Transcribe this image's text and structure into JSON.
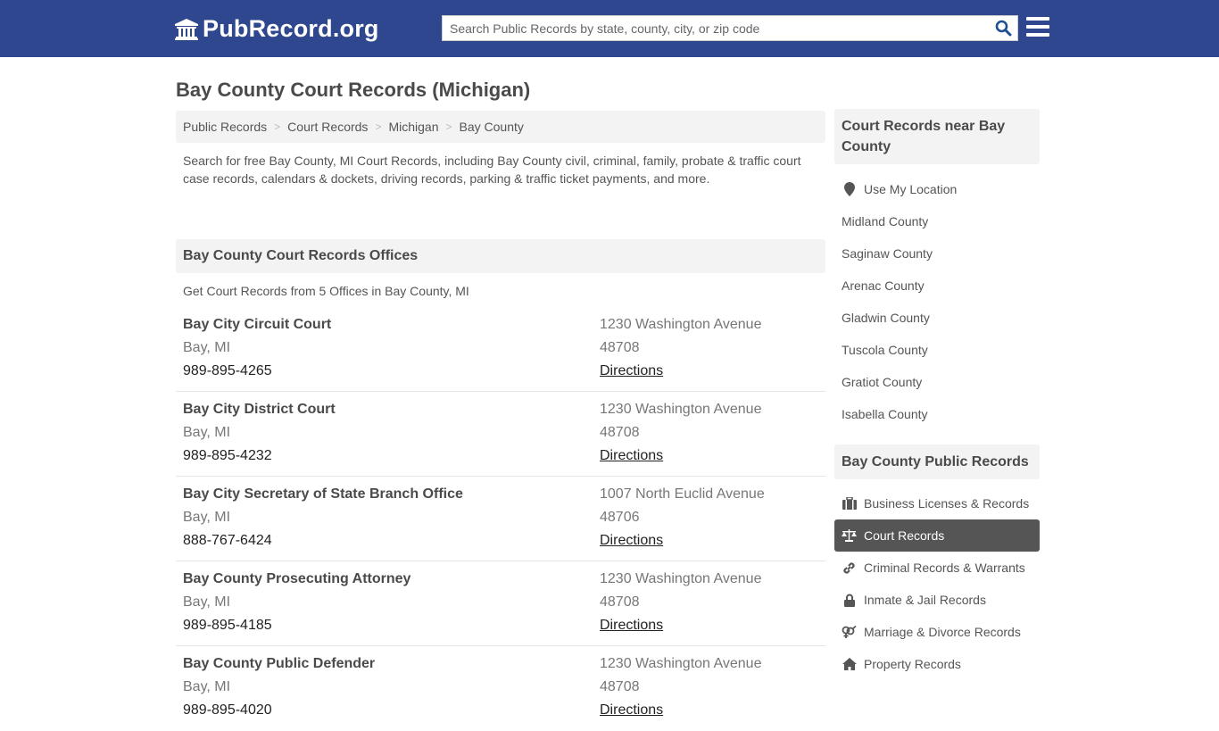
{
  "header": {
    "logo_text": "PubRecord.org",
    "search_placeholder": "Search Public Records by state, county, city, or zip code",
    "search_value": ""
  },
  "page": {
    "title": "Bay County Court Records (Michigan)"
  },
  "breadcrumb": [
    {
      "label": "Public Records"
    },
    {
      "label": "Court Records"
    },
    {
      "label": "Michigan"
    },
    {
      "label": "Bay County"
    }
  ],
  "intro": "Search for free Bay County, MI Court Records, including Bay County civil, criminal, family, probate & traffic court case records, calendars & dockets, driving records, parking & traffic ticket payments, and more.",
  "offices_section": {
    "title": "Bay County Court Records Offices",
    "subtitle": "Get Court Records from 5 Offices in Bay County, MI",
    "offices": [
      {
        "name": "Bay City Circuit Court",
        "location": "Bay, MI",
        "phone": "989-895-4265",
        "address": "1230 Washington Avenue",
        "zip": "48708",
        "directions": "Directions"
      },
      {
        "name": "Bay City District Court",
        "location": "Bay, MI",
        "phone": "989-895-4232",
        "address": "1230 Washington Avenue",
        "zip": "48708",
        "directions": "Directions"
      },
      {
        "name": "Bay City Secretary of State Branch Office",
        "location": "Bay, MI",
        "phone": "888-767-6424",
        "address": "1007 North Euclid Avenue",
        "zip": "48706",
        "directions": "Directions"
      },
      {
        "name": "Bay County Prosecuting Attorney",
        "location": "Bay, MI",
        "phone": "989-895-4185",
        "address": "1230 Washington Avenue",
        "zip": "48708",
        "directions": "Directions"
      },
      {
        "name": "Bay County Public Defender",
        "location": "Bay, MI",
        "phone": "989-895-4020",
        "address": "1230 Washington Avenue",
        "zip": "48708",
        "directions": "Directions"
      }
    ]
  },
  "sidebar": {
    "nearby_title": "Court Records near Bay County",
    "use_location": {
      "label": "Use My Location",
      "icon": "map-marker-icon"
    },
    "nearby": [
      {
        "label": "Midland County"
      },
      {
        "label": "Saginaw County"
      },
      {
        "label": "Arenac County"
      },
      {
        "label": "Gladwin County"
      },
      {
        "label": "Tuscola County"
      },
      {
        "label": "Gratiot County"
      },
      {
        "label": "Isabella County"
      }
    ],
    "records_title": "Bay County Public Records",
    "records": [
      {
        "label": "Business Licenses & Records",
        "icon": "briefcase-icon",
        "active": false
      },
      {
        "label": "Court Records",
        "icon": "balance-scale-icon",
        "active": true
      },
      {
        "label": "Criminal Records & Warrants",
        "icon": "link-icon",
        "active": false
      },
      {
        "label": "Inmate & Jail Records",
        "icon": "lock-icon",
        "active": false
      },
      {
        "label": "Marriage & Divorce Records",
        "icon": "venus-mars-icon",
        "active": false
      },
      {
        "label": "Property Records",
        "icon": "home-icon",
        "active": false
      }
    ]
  },
  "colors": {
    "header_bg": "#2e478f",
    "search_icon": "#1d4f91",
    "active_item_bg": "#555555",
    "panel_bg": "#f3f3f3"
  }
}
